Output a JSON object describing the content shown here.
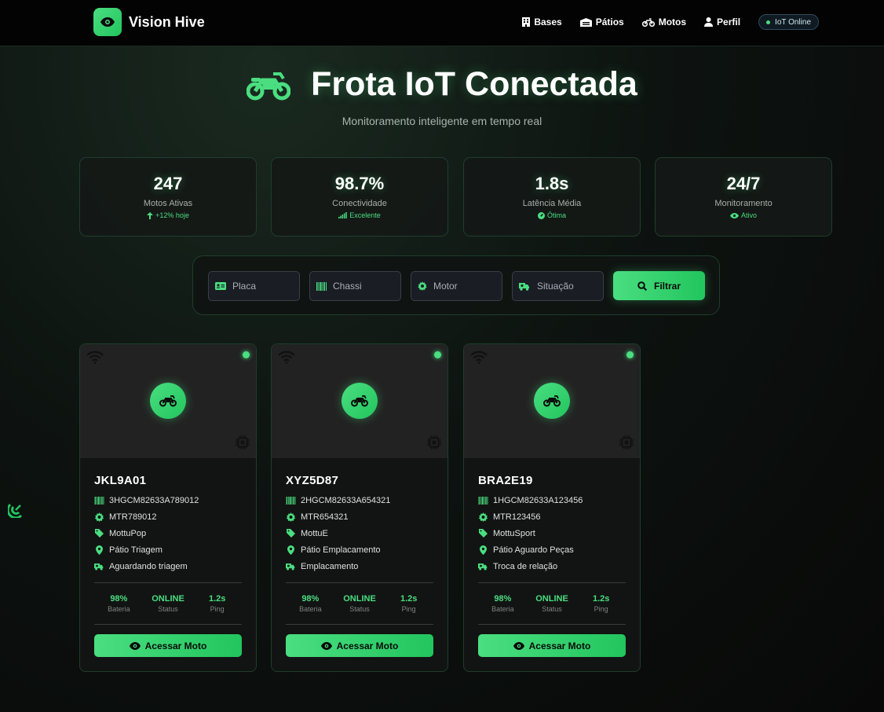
{
  "brand": {
    "name": "Vision Hive",
    "logo_icon": "eye-icon"
  },
  "nav": {
    "items": [
      {
        "label": "Bases",
        "icon": "building-icon"
      },
      {
        "label": "Pátios",
        "icon": "warehouse-icon"
      },
      {
        "label": "Motos",
        "icon": "motorcycle-icon"
      },
      {
        "label": "Perfil",
        "icon": "user-icon"
      }
    ],
    "status_badge": "IoT Online"
  },
  "hero": {
    "title": "Frota IoT Conectada",
    "subtitle": "Monitoramento inteligente em tempo real"
  },
  "stats": [
    {
      "value": "247",
      "label": "Motos Ativas",
      "trend": "+12% hoje",
      "icon": "arrow-up-icon"
    },
    {
      "value": "98.7%",
      "label": "Conectividade",
      "trend": "Excelente",
      "icon": "signal-icon"
    },
    {
      "value": "1.8s",
      "label": "Latência Média",
      "trend": "Ótima",
      "icon": "gauge-icon"
    },
    {
      "value": "24/7",
      "label": "Monitoramento",
      "trend": "Ativo",
      "icon": "eye-icon"
    }
  ],
  "filters": {
    "placa_placeholder": "Placa",
    "chassi_placeholder": "Chassi",
    "motor_placeholder": "Motor",
    "situacao_placeholder": "Situação",
    "button_label": "Filtrar"
  },
  "motos": [
    {
      "plate": "JKL9A01",
      "chassi": "3HGCM82633A789012",
      "motor": "MTR789012",
      "modelo": "MottuPop",
      "patio": "Pátio Triagem",
      "situacao": "Aguardando triagem",
      "bateria": "98%",
      "status": "ONLINE",
      "ping": "1.2s"
    },
    {
      "plate": "XYZ5D87",
      "chassi": "2HGCM82633A654321",
      "motor": "MTR654321",
      "modelo": "MottuE",
      "patio": "Pátio Emplacamento",
      "situacao": "Emplacamento",
      "bateria": "98%",
      "status": "ONLINE",
      "ping": "1.2s"
    },
    {
      "plate": "BRA2E19",
      "chassi": "1HGCM82633A123456",
      "motor": "MTR123456",
      "modelo": "MottuSport",
      "patio": "Pátio Aguardo Peças",
      "situacao": "Troca de relação",
      "bateria": "98%",
      "status": "ONLINE",
      "ping": "1.2s"
    }
  ],
  "card_labels": {
    "bateria": "Bateria",
    "status": "Status",
    "ping": "Ping",
    "button": "Acessar Moto"
  },
  "colors": {
    "accent": "#4ade80",
    "accent_dark": "#22c55e",
    "background": "#0a0f0c",
    "card": "#121413"
  }
}
